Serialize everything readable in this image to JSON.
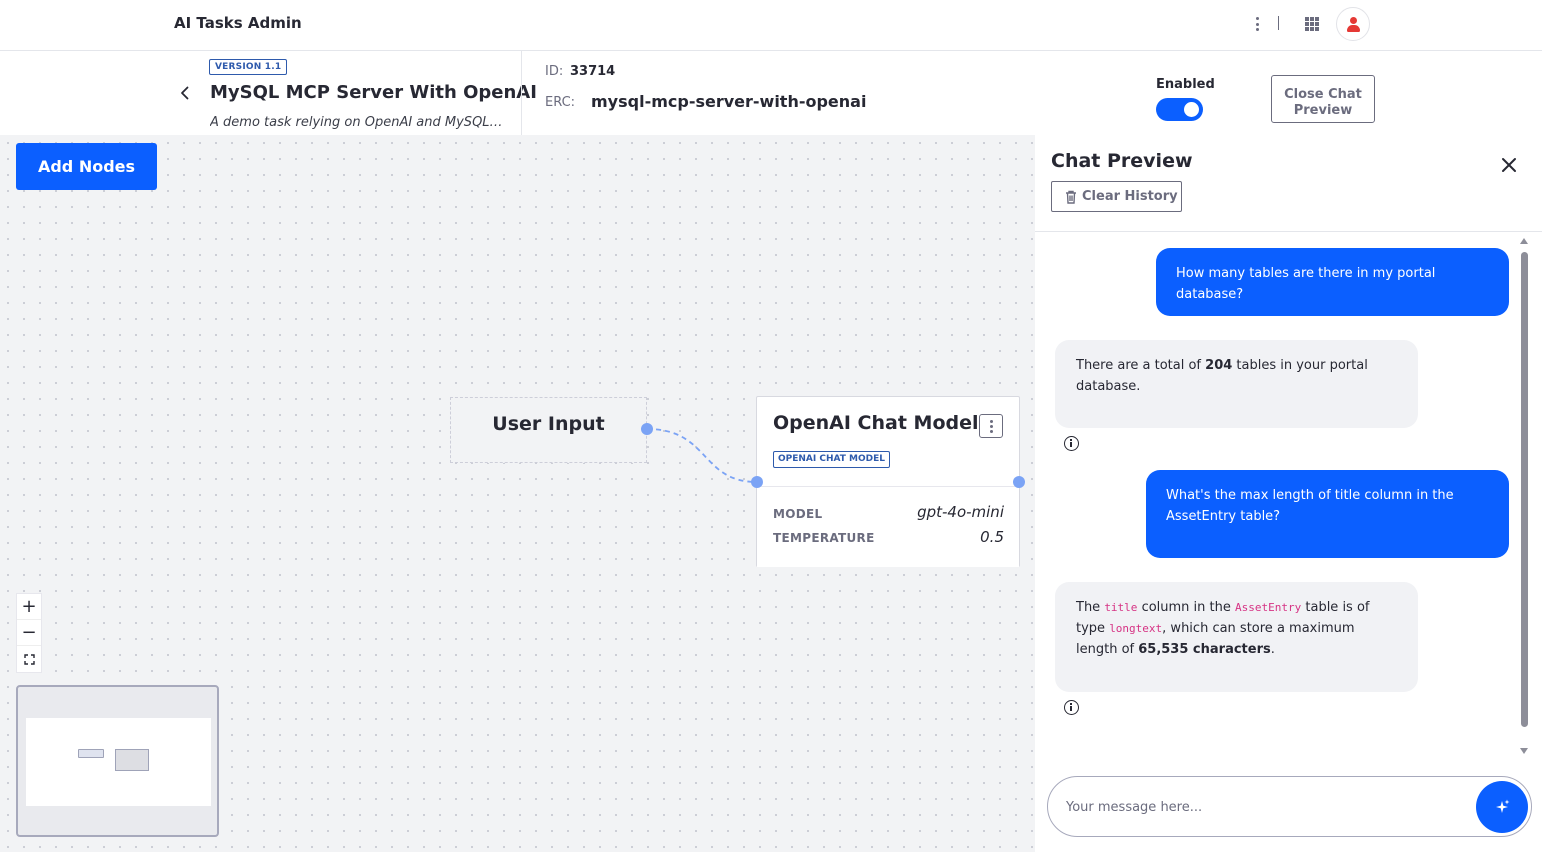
{
  "app": {
    "title": "AI Tasks Admin"
  },
  "task": {
    "version": "VERSION 1.1",
    "name": "MySQL MCP Server With OpenAI",
    "description": "A demo task relying on OpenAI and MySQL MC...",
    "id_label": "ID:",
    "id_value": "33714",
    "erc_label": "ERC:",
    "erc_value": "mysql-mcp-server-with-openai",
    "enabled_label": "Enabled",
    "enabled": true,
    "close_preview_label": "Close Chat Preview"
  },
  "canvas": {
    "add_nodes_label": "Add Nodes",
    "nodes": {
      "user_input": {
        "title": "User Input"
      },
      "openai": {
        "title": "OpenAI Chat Model",
        "type_badge": "OPENAI CHAT MODEL",
        "props": [
          {
            "label": "MODEL",
            "value": "gpt-4o-mini"
          },
          {
            "label": "TEMPERATURE",
            "value": "0.5"
          }
        ]
      }
    },
    "zoom": {
      "in": "+",
      "out": "−"
    }
  },
  "chat": {
    "title": "Chat Preview",
    "clear_history_label": "Clear History",
    "messages": [
      {
        "role": "user",
        "text": "How many tables are there in my portal database?"
      },
      {
        "role": "bot",
        "parts": [
          "There are a total of ",
          "204",
          " tables in your portal database."
        ]
      },
      {
        "role": "user",
        "text": "What's the max length of title column in the AssetEntry table?"
      },
      {
        "role": "bot",
        "parts": [
          "The ",
          "title",
          " column in the ",
          "AssetEntry",
          " table is of type ",
          "longtext",
          ", which can store a maximum length of ",
          "65,535 characters",
          "."
        ]
      }
    ],
    "input_placeholder": "Your message here..."
  },
  "colors": {
    "accent": "#0b5fff",
    "badge": "#2e5aac",
    "danger": "#e53935",
    "code": "#d63384"
  }
}
